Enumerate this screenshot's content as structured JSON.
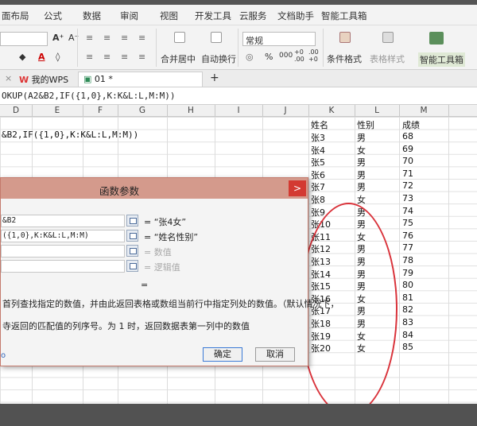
{
  "menu": [
    "面布局",
    "公式",
    "数据",
    "审阅",
    "视图",
    "开发工具",
    "云服务",
    "文档助手",
    "智能工具箱"
  ],
  "ribbon": {
    "merge_center": "合并居中",
    "auto_wrap": "自动换行",
    "number_format": "常规",
    "conditional_format": "条件格式",
    "table_style": "表格样式",
    "smart_toolbox": "智能工具箱",
    "percent": "%",
    "thousands": "000"
  },
  "tabs": {
    "wps": "我的WPS",
    "file": "01 *",
    "add": "+"
  },
  "formula_bar": "OKUP(A2&B2,IF({1,0},K:K&L:L,M:M))",
  "columns": [
    "D",
    "E",
    "F",
    "G",
    "H",
    "I",
    "J",
    "K",
    "L",
    "M"
  ],
  "cell_formula": "&B2,IF({1,0},K:K&L:L,M:M))",
  "table": {
    "headers": [
      "姓名",
      "性别",
      "成绩"
    ],
    "rows": [
      [
        "张3",
        "男",
        "68"
      ],
      [
        "张4",
        "女",
        "69"
      ],
      [
        "张5",
        "男",
        "70"
      ],
      [
        "张6",
        "男",
        "71"
      ],
      [
        "张7",
        "男",
        "72"
      ],
      [
        "张8",
        "女",
        "73"
      ],
      [
        "张9",
        "男",
        "74"
      ],
      [
        "张10",
        "男",
        "75"
      ],
      [
        "张11",
        "女",
        "76"
      ],
      [
        "张12",
        "男",
        "77"
      ],
      [
        "张13",
        "男",
        "78"
      ],
      [
        "张14",
        "男",
        "79"
      ],
      [
        "张15",
        "男",
        "80"
      ],
      [
        "张16",
        "女",
        "81"
      ],
      [
        "张17",
        "男",
        "82"
      ],
      [
        "张18",
        "男",
        "83"
      ],
      [
        "张19",
        "女",
        "84"
      ],
      [
        "张20",
        "女",
        "85"
      ]
    ]
  },
  "dialog": {
    "title": "函数参数",
    "close": ">",
    "args": [
      {
        "value": "&B2",
        "result": "= “张4女”"
      },
      {
        "value": "({1,0},K:K&L:L,M:M)",
        "result": "= “姓名性别”"
      },
      {
        "value": "",
        "result": "= 数值"
      },
      {
        "value": "",
        "result": "= 逻辑值"
      }
    ],
    "equals": "=",
    "desc1": "首列查找指定的数值，并由此返回表格或数组当前行中指定列处的数值。（默认情况下，",
    "desc2": "寺返回的匹配值的列序号。为 1 时，返回数据表第一列中的数值",
    "ok": "确定",
    "cancel": "取消",
    "left_mark": "o"
  },
  "colors": {
    "oval": "#d9323a",
    "dialog_title": "#d49a8c",
    "close": "#d33a32"
  }
}
